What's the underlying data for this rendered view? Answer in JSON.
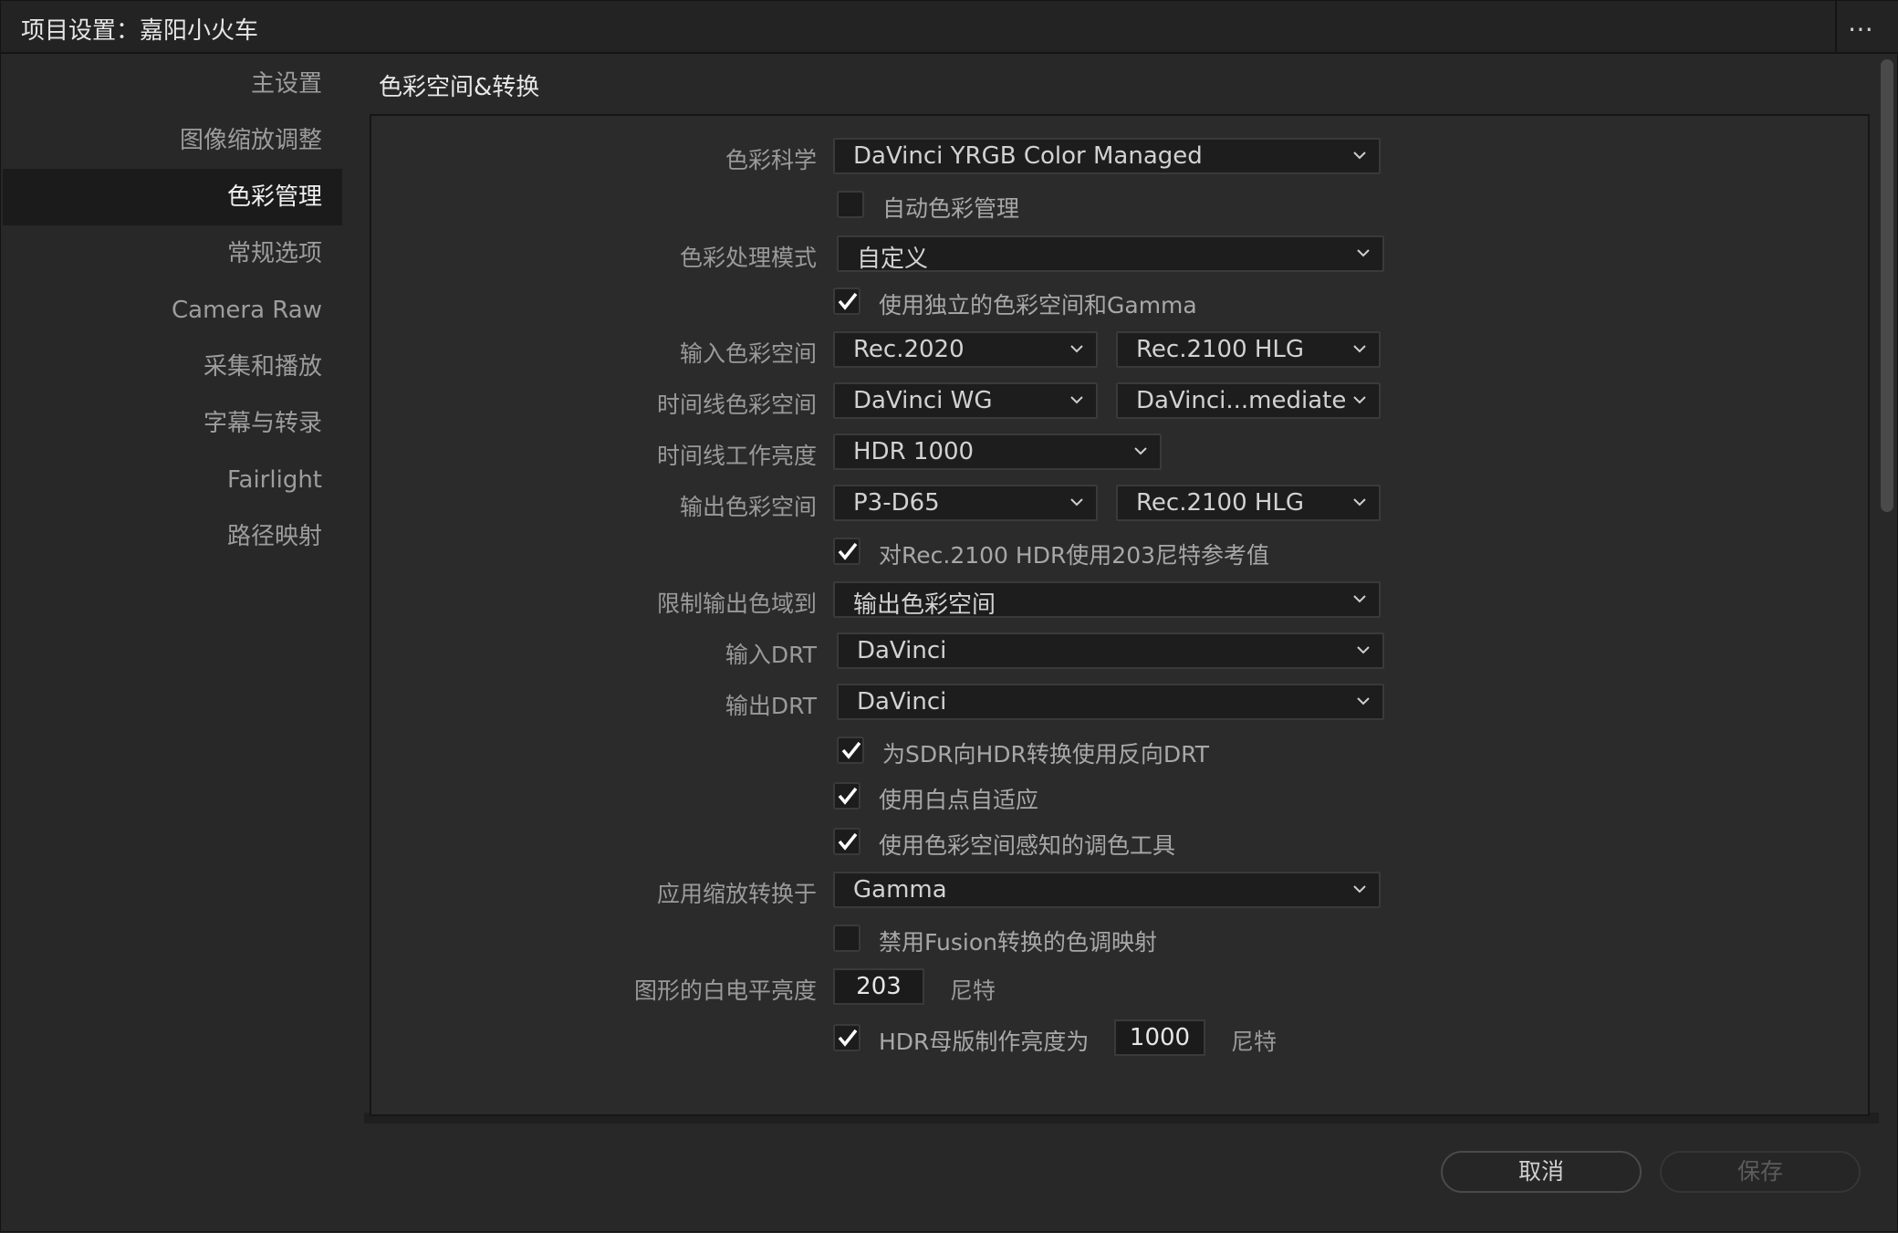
{
  "titlebar": {
    "title": "项目设置：嘉阳小火车",
    "more_icon": "⋯"
  },
  "sidebar": {
    "items": [
      {
        "label": "主设置"
      },
      {
        "label": "图像缩放调整"
      },
      {
        "label": "色彩管理",
        "active": true
      },
      {
        "label": "常规选项"
      },
      {
        "label": "Camera Raw"
      },
      {
        "label": "采集和播放"
      },
      {
        "label": "字幕与转录"
      },
      {
        "label": "Fairlight"
      },
      {
        "label": "路径映射"
      }
    ]
  },
  "section": {
    "title": "色彩空间&转换"
  },
  "form": {
    "color_science": {
      "label": "色彩科学",
      "value": "DaVinci YRGB Color Managed"
    },
    "auto_color_management": {
      "label": "自动色彩管理",
      "checked": false
    },
    "color_processing_mode": {
      "label": "色彩处理模式",
      "value": "自定义"
    },
    "separate_space_gamma": {
      "label": "使用独立的色彩空间和Gamma",
      "checked": true
    },
    "input_color_space": {
      "label": "输入色彩空间",
      "value": "Rec.2020",
      "gamma": "Rec.2100 HLG"
    },
    "timeline_color_space": {
      "label": "时间线色彩空间",
      "value": "DaVinci WG",
      "gamma": "DaVinci...mediate"
    },
    "timeline_working_luminance": {
      "label": "时间线工作亮度",
      "value": "HDR 1000"
    },
    "output_color_space": {
      "label": "输出色彩空间",
      "value": "P3-D65",
      "gamma": "Rec.2100 HLG"
    },
    "rec2100_ref": {
      "label": "对Rec.2100 HDR使用203尼特参考值",
      "checked": true
    },
    "limit_output_gamut": {
      "label": "限制输出色域到",
      "value": "输出色彩空间"
    },
    "input_drt": {
      "label": "输入DRT",
      "value": "DaVinci"
    },
    "output_drt": {
      "label": "输出DRT",
      "value": "DaVinci"
    },
    "inverse_drt": {
      "label": "为SDR向HDR转换使用反向DRT",
      "checked": true
    },
    "white_point_adapt": {
      "label": "使用白点自适应",
      "checked": true
    },
    "space_aware_tools": {
      "label": "使用色彩空间感知的调色工具",
      "checked": true
    },
    "apply_resize_in": {
      "label": "应用缩放转换于",
      "value": "Gamma"
    },
    "disable_fusion_tonemap": {
      "label": "禁用Fusion转换的色调映射",
      "checked": false
    },
    "graphics_white_level": {
      "label": "图形的白电平亮度",
      "value": "203",
      "unit": "尼特"
    },
    "hdr_mastering": {
      "label": "HDR母版制作亮度为",
      "checked": true,
      "value": "1000",
      "unit": "尼特"
    }
  },
  "footer": {
    "cancel_label": "取消",
    "save_label": "保存"
  }
}
